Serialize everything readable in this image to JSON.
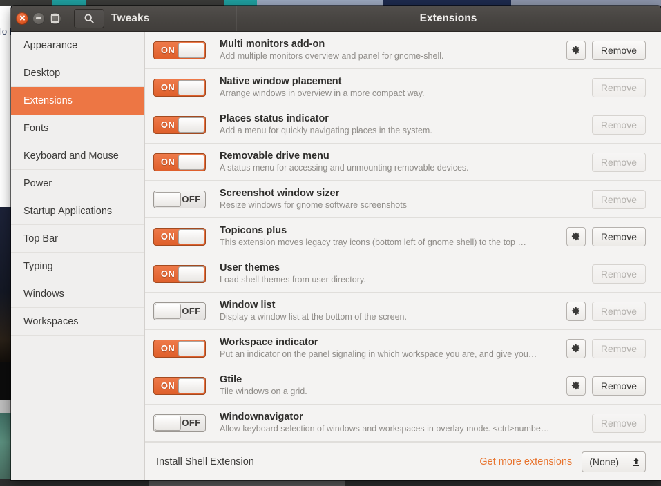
{
  "window": {
    "app_title": "Tweaks",
    "page_title": "Extensions",
    "controls": {
      "close": "close-button",
      "minimize": "minimize-button",
      "maximize": "maximize-button"
    },
    "search_icon": "search-icon"
  },
  "background": {
    "behind_text": "lo P ( C"
  },
  "sidebar": {
    "items": [
      {
        "label": "Appearance",
        "selected": false
      },
      {
        "label": "Desktop",
        "selected": false
      },
      {
        "label": "Extensions",
        "selected": true
      },
      {
        "label": "Fonts",
        "selected": false
      },
      {
        "label": "Keyboard and Mouse",
        "selected": false
      },
      {
        "label": "Power",
        "selected": false
      },
      {
        "label": "Startup Applications",
        "selected": false
      },
      {
        "label": "Top Bar",
        "selected": false
      },
      {
        "label": "Typing",
        "selected": false
      },
      {
        "label": "Windows",
        "selected": false
      },
      {
        "label": "Workspaces",
        "selected": false
      }
    ]
  },
  "extensions": [
    {
      "name": "Multi monitors add-on",
      "description": "Add multiple monitors overview and panel for gnome-shell.",
      "enabled": true,
      "toggle_label": "ON",
      "has_settings": true,
      "remove_label": "Remove",
      "remove_enabled": true
    },
    {
      "name": "Native window placement",
      "description": "Arrange windows in overview in a more compact way.",
      "enabled": true,
      "toggle_label": "ON",
      "has_settings": false,
      "remove_label": "Remove",
      "remove_enabled": false
    },
    {
      "name": "Places status indicator",
      "description": "Add a menu for quickly navigating places in the system.",
      "enabled": true,
      "toggle_label": "ON",
      "has_settings": false,
      "remove_label": "Remove",
      "remove_enabled": false
    },
    {
      "name": "Removable drive menu",
      "description": "A status menu for accessing and unmounting removable devices.",
      "enabled": true,
      "toggle_label": "ON",
      "has_settings": false,
      "remove_label": "Remove",
      "remove_enabled": false
    },
    {
      "name": "Screenshot window sizer",
      "description": "Resize windows for gnome software screenshots",
      "enabled": false,
      "toggle_label": "OFF",
      "has_settings": false,
      "remove_label": "Remove",
      "remove_enabled": false
    },
    {
      "name": "Topicons plus",
      "description": "This extension moves legacy tray icons (bottom left of gnome shell) to the top …",
      "enabled": true,
      "toggle_label": "ON",
      "has_settings": true,
      "remove_label": "Remove",
      "remove_enabled": true
    },
    {
      "name": "User themes",
      "description": "Load shell themes from user directory.",
      "enabled": true,
      "toggle_label": "ON",
      "has_settings": false,
      "remove_label": "Remove",
      "remove_enabled": false
    },
    {
      "name": "Window list",
      "description": "Display a window list at the bottom of the screen.",
      "enabled": false,
      "toggle_label": "OFF",
      "has_settings": true,
      "remove_label": "Remove",
      "remove_enabled": false
    },
    {
      "name": "Workspace indicator",
      "description": "Put an indicator on the panel signaling in which workspace you are, and give you…",
      "enabled": true,
      "toggle_label": "ON",
      "has_settings": true,
      "remove_label": "Remove",
      "remove_enabled": false
    },
    {
      "name": "Gtile",
      "description": "Tile windows on a grid.",
      "enabled": true,
      "toggle_label": "ON",
      "has_settings": true,
      "remove_label": "Remove",
      "remove_enabled": true
    },
    {
      "name": "Windownavigator",
      "description": "Allow keyboard selection of windows and workspaces in overlay mode. <ctrl>numbe…",
      "enabled": false,
      "toggle_label": "OFF",
      "has_settings": false,
      "remove_label": "Remove",
      "remove_enabled": false
    }
  ],
  "footer": {
    "install_label": "Install Shell Extension",
    "get_more_label": "Get more extensions",
    "file_value": "(None)",
    "file_button_icon": "upload-icon"
  },
  "colors": {
    "accent": "#ed7644",
    "link": "#e8742f",
    "toggle_on": "#df5f2b",
    "titlebar": "#474441"
  }
}
